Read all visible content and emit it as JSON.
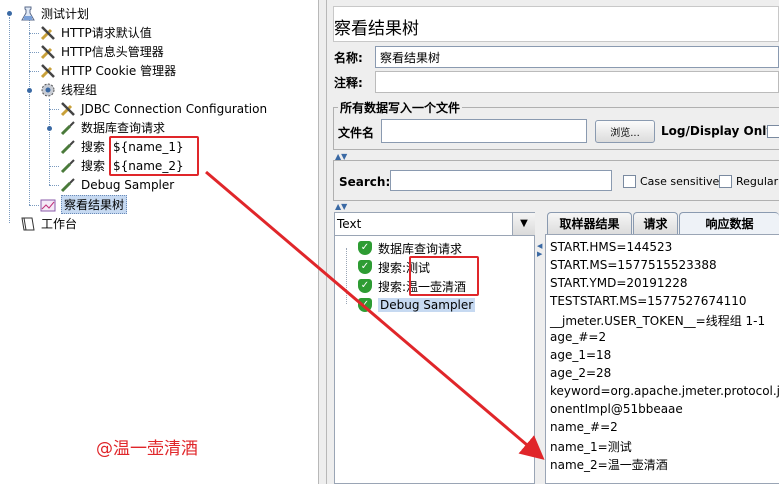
{
  "left_tree": {
    "test_plan": "测试计划",
    "http_defaults": "HTTP请求默认值",
    "http_header": "HTTP信息头管理器",
    "http_cookie": "HTTP Cookie 管理器",
    "thread_group": "线程组",
    "jdbc_config": "JDBC Connection Configuration",
    "db_request": "数据库查询请求",
    "search1_prefix": "搜索",
    "search1_value": "${name_1}",
    "search2_prefix": "搜索",
    "search2_value": "${name_2}",
    "debug_sampler": "Debug Sampler",
    "view_results_tree": "察看结果树",
    "workbench": "工作台"
  },
  "watermark": "@温一壶清酒",
  "panel": {
    "title": "察看结果树",
    "name_label": "名称:",
    "name_value": "察看结果树",
    "comment_label": "注释:",
    "file_section": "所有数据写入一个文件",
    "filename_label": "文件名",
    "filename_value": "",
    "browse_button": "浏览...",
    "log_display_label": "Log/Display Only:"
  },
  "search": {
    "label": "Search:",
    "value": "",
    "case_sensitive": "Case sensitive",
    "regular_exp": "Regular e"
  },
  "renderer": {
    "selected": "Text"
  },
  "results": [
    {
      "prefix": "数据库查询请求",
      "value": ""
    },
    {
      "prefix": "搜索:",
      "value": "测试"
    },
    {
      "prefix": "搜索:",
      "value": "温一壶清酒"
    },
    {
      "prefix": "Debug Sampler",
      "value": ""
    }
  ],
  "tabs": [
    "取样器结果",
    "请求",
    "响应数据"
  ],
  "active_tab": "响应数据",
  "response_lines": [
    "START.HMS=144523",
    "START.MS=1577515523388",
    "START.YMD=20191228",
    "TESTSTART.MS=1577527674110",
    "__jmeter.USER_TOKEN__=线程组 1-1",
    "age_#=2",
    "age_1=18",
    "age_2=28",
    "keyword=org.apache.jmeter.protocol.jdbc.",
    "onentImpl@51bbeaae",
    "name_#=2",
    "name_1=测试",
    "name_2=温一壶清酒"
  ],
  "colors": {
    "annotation_red": "#e0262a",
    "pass_green": "#2e9c33",
    "selection": "#c6d9f1"
  }
}
